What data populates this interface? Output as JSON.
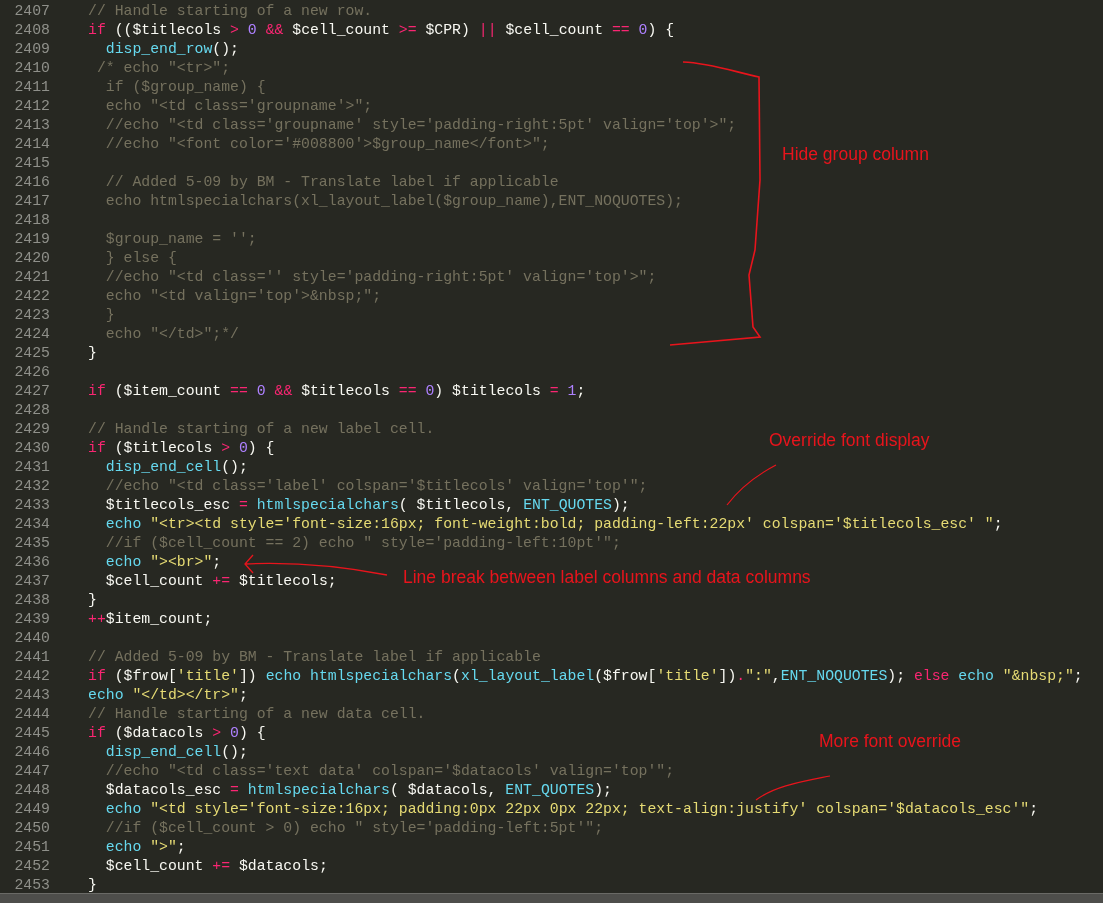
{
  "editor": {
    "lines": [
      {
        "no": "2407",
        "tokens": [
          {
            "kind": "cm",
            "text": "// Handle starting of a new row."
          }
        ]
      },
      {
        "no": "2408",
        "tokens": [
          {
            "kind": "kw",
            "text": "if"
          },
          {
            "kind": "tx",
            "text": " (($titlecols "
          },
          {
            "kind": "kw",
            "text": "> "
          },
          {
            "kind": "num",
            "text": "0 "
          },
          {
            "kind": "kw",
            "text": "&&"
          },
          {
            "kind": "tx",
            "text": " $cell_count "
          },
          {
            "kind": "kw",
            "text": ">="
          },
          {
            "kind": "tx",
            "text": " $CPR) "
          },
          {
            "kind": "kw",
            "text": "||"
          },
          {
            "kind": "tx",
            "text": " $cell_count "
          },
          {
            "kind": "kw",
            "text": "== "
          },
          {
            "kind": "num",
            "text": "0"
          },
          {
            "kind": "tx",
            "text": ") {"
          }
        ]
      },
      {
        "no": "2409",
        "tokens": [
          {
            "kind": "fn",
            "text": "  disp_end_row"
          },
          {
            "kind": "tx",
            "text": "();"
          }
        ]
      },
      {
        "no": "2410",
        "tokens": [
          {
            "kind": "cm",
            "text": " /* echo \"<tr>\";"
          }
        ]
      },
      {
        "no": "2411",
        "tokens": [
          {
            "kind": "cm",
            "text": "  if ($group_name) {"
          }
        ]
      },
      {
        "no": "2412",
        "tokens": [
          {
            "kind": "cm",
            "text": "  echo \"<td class='groupname'>\";"
          }
        ]
      },
      {
        "no": "2413",
        "tokens": [
          {
            "kind": "cm",
            "text": "  //echo \"<td class='groupname' style='padding-right:5pt' valign='top'>\";"
          }
        ]
      },
      {
        "no": "2414",
        "tokens": [
          {
            "kind": "cm",
            "text": "  //echo \"<font color='#008800'>$group_name</font>\";"
          }
        ]
      },
      {
        "no": "2415"
      },
      {
        "no": "2416",
        "tokens": [
          {
            "kind": "cm",
            "text": "  // Added 5-09 by BM - Translate label if applicable"
          }
        ]
      },
      {
        "no": "2417",
        "tokens": [
          {
            "kind": "cm",
            "text": "  echo htmlspecialchars(xl_layout_label($group_name),ENT_NOQUOTES);"
          }
        ]
      },
      {
        "no": "2418"
      },
      {
        "no": "2419",
        "tokens": [
          {
            "kind": "cm",
            "text": "  $group_name = '';"
          }
        ]
      },
      {
        "no": "2420",
        "tokens": [
          {
            "kind": "cm",
            "text": "  } else {"
          }
        ]
      },
      {
        "no": "2421",
        "tokens": [
          {
            "kind": "cm",
            "text": "  //echo \"<td class='' style='padding-right:5pt' valign='top'>\";"
          }
        ]
      },
      {
        "no": "2422",
        "tokens": [
          {
            "kind": "cm",
            "text": "  echo \"<td valign='top'>&nbsp;\";"
          }
        ]
      },
      {
        "no": "2423",
        "tokens": [
          {
            "kind": "cm",
            "text": "  }"
          }
        ]
      },
      {
        "no": "2424",
        "tokens": [
          {
            "kind": "cm",
            "text": "  echo \"</td>\";*/"
          }
        ]
      },
      {
        "no": "2425",
        "tokens": [
          {
            "kind": "tx",
            "text": "}"
          }
        ]
      },
      {
        "no": "2426"
      },
      {
        "no": "2427",
        "tokens": [
          {
            "kind": "kw",
            "text": "if"
          },
          {
            "kind": "tx",
            "text": " ($item_count "
          },
          {
            "kind": "kw",
            "text": "== "
          },
          {
            "kind": "num",
            "text": "0 "
          },
          {
            "kind": "kw",
            "text": "&&"
          },
          {
            "kind": "tx",
            "text": " $titlecols "
          },
          {
            "kind": "kw",
            "text": "== "
          },
          {
            "kind": "num",
            "text": "0"
          },
          {
            "kind": "tx",
            "text": ") $titlecols "
          },
          {
            "kind": "kw",
            "text": "= "
          },
          {
            "kind": "num",
            "text": "1"
          },
          {
            "kind": "tx",
            "text": ";"
          }
        ]
      },
      {
        "no": "2428"
      },
      {
        "no": "2429",
        "tokens": [
          {
            "kind": "cm",
            "text": "// Handle starting of a new label cell."
          }
        ]
      },
      {
        "no": "2430",
        "tokens": [
          {
            "kind": "kw",
            "text": "if"
          },
          {
            "kind": "tx",
            "text": " ($titlecols "
          },
          {
            "kind": "kw",
            "text": "> "
          },
          {
            "kind": "num",
            "text": "0"
          },
          {
            "kind": "tx",
            "text": ") {"
          }
        ]
      },
      {
        "no": "2431",
        "tokens": [
          {
            "kind": "fn",
            "text": "  disp_end_cell"
          },
          {
            "kind": "tx",
            "text": "();"
          }
        ]
      },
      {
        "no": "2432",
        "tokens": [
          {
            "kind": "cm",
            "text": "  //echo \"<td class='label' colspan='$titlecols' valign='top'\";"
          }
        ]
      },
      {
        "no": "2433",
        "tokens": [
          {
            "kind": "tx",
            "text": "  $titlecols_esc "
          },
          {
            "kind": "kw",
            "text": "= "
          },
          {
            "kind": "fn",
            "text": "htmlspecialchars"
          },
          {
            "kind": "tx",
            "text": "( $titlecols, "
          },
          {
            "kind": "fn",
            "text": "ENT_QUOTES"
          },
          {
            "kind": "tx",
            "text": ");"
          }
        ]
      },
      {
        "no": "2434",
        "tokens": [
          {
            "kind": "fn",
            "text": "  echo "
          },
          {
            "kind": "str",
            "text": "\"<tr><td style='font-size:16px; font-weight:bold; padding-left:22px' colspan='$titlecols_esc' \""
          },
          {
            "kind": "tx",
            "text": ";"
          }
        ]
      },
      {
        "no": "2435",
        "tokens": [
          {
            "kind": "cm",
            "text": "  //if ($cell_count == 2) echo \" style='padding-left:10pt'\";"
          }
        ]
      },
      {
        "no": "2436",
        "tokens": [
          {
            "kind": "fn",
            "text": "  echo "
          },
          {
            "kind": "str",
            "text": "\"><br>\""
          },
          {
            "kind": "tx",
            "text": ";"
          }
        ]
      },
      {
        "no": "2437",
        "tokens": [
          {
            "kind": "tx",
            "text": "  $cell_count "
          },
          {
            "kind": "kw",
            "text": "+="
          },
          {
            "kind": "tx",
            "text": " $titlecols;"
          }
        ]
      },
      {
        "no": "2438",
        "tokens": [
          {
            "kind": "tx",
            "text": "}"
          }
        ]
      },
      {
        "no": "2439",
        "tokens": [
          {
            "kind": "kw",
            "text": "++"
          },
          {
            "kind": "tx",
            "text": "$item_count;"
          }
        ]
      },
      {
        "no": "2440"
      },
      {
        "no": "2441",
        "tokens": [
          {
            "kind": "cm",
            "text": "// Added 5-09 by BM - Translate label if applicable"
          }
        ]
      },
      {
        "no": "2442",
        "tokens": [
          {
            "kind": "kw",
            "text": "if"
          },
          {
            "kind": "tx",
            "text": " ($frow["
          },
          {
            "kind": "str",
            "text": "'title'"
          },
          {
            "kind": "tx",
            "text": "]) "
          },
          {
            "kind": "fn",
            "text": "echo htmlspecialchars"
          },
          {
            "kind": "tx",
            "text": "("
          },
          {
            "kind": "fn",
            "text": "xl_layout_label"
          },
          {
            "kind": "tx",
            "text": "($frow["
          },
          {
            "kind": "str",
            "text": "'title'"
          },
          {
            "kind": "tx",
            "text": "])"
          },
          {
            "kind": "kw",
            "text": "."
          },
          {
            "kind": "str",
            "text": "\":\""
          },
          {
            "kind": "tx",
            "text": ","
          },
          {
            "kind": "fn",
            "text": "ENT_NOQUOTES"
          },
          {
            "kind": "tx",
            "text": "); "
          },
          {
            "kind": "kw",
            "text": "else "
          },
          {
            "kind": "fn",
            "text": "echo "
          },
          {
            "kind": "str",
            "text": "\"&nbsp;\""
          },
          {
            "kind": "tx",
            "text": ";"
          }
        ]
      },
      {
        "no": "2443",
        "tokens": [
          {
            "kind": "fn",
            "text": "echo "
          },
          {
            "kind": "str",
            "text": "\"</td></tr>\""
          },
          {
            "kind": "tx",
            "text": ";"
          }
        ]
      },
      {
        "no": "2444",
        "tokens": [
          {
            "kind": "cm",
            "text": "// Handle starting of a new data cell."
          }
        ]
      },
      {
        "no": "2445",
        "tokens": [
          {
            "kind": "kw",
            "text": "if"
          },
          {
            "kind": "tx",
            "text": " ($datacols "
          },
          {
            "kind": "kw",
            "text": "> "
          },
          {
            "kind": "num",
            "text": "0"
          },
          {
            "kind": "tx",
            "text": ") {"
          }
        ]
      },
      {
        "no": "2446",
        "tokens": [
          {
            "kind": "fn",
            "text": "  disp_end_cell"
          },
          {
            "kind": "tx",
            "text": "();"
          }
        ]
      },
      {
        "no": "2447",
        "tokens": [
          {
            "kind": "cm",
            "text": "  //echo \"<td class='text data' colspan='$datacols' valign='top'\";"
          }
        ]
      },
      {
        "no": "2448",
        "tokens": [
          {
            "kind": "tx",
            "text": "  $datacols_esc "
          },
          {
            "kind": "kw",
            "text": "= "
          },
          {
            "kind": "fn",
            "text": "htmlspecialchars"
          },
          {
            "kind": "tx",
            "text": "( $datacols, "
          },
          {
            "kind": "fn",
            "text": "ENT_QUOTES"
          },
          {
            "kind": "tx",
            "text": ");"
          }
        ]
      },
      {
        "no": "2449",
        "tokens": [
          {
            "kind": "fn",
            "text": "  echo "
          },
          {
            "kind": "str",
            "text": "\"<td style='font-size:16px; padding:0px 22px 0px 22px; text-align:justify' colspan='$datacols_esc'\""
          },
          {
            "kind": "tx",
            "text": ";"
          }
        ]
      },
      {
        "no": "2450",
        "tokens": [
          {
            "kind": "cm",
            "text": "  //if ($cell_count > 0) echo \" style='padding-left:5pt'\";"
          }
        ]
      },
      {
        "no": "2451",
        "tokens": [
          {
            "kind": "fn",
            "text": "  echo "
          },
          {
            "kind": "str",
            "text": "\">\""
          },
          {
            "kind": "tx",
            "text": ";"
          }
        ]
      },
      {
        "no": "2452",
        "tokens": [
          {
            "kind": "tx",
            "text": "  $cell_count "
          },
          {
            "kind": "kw",
            "text": "+="
          },
          {
            "kind": "tx",
            "text": " $datacols;"
          }
        ]
      },
      {
        "no": "2453",
        "tokens": [
          {
            "kind": "tx",
            "text": "}"
          }
        ]
      }
    ]
  },
  "annotations": [
    {
      "kind": "bracket",
      "text": "Hide group column"
    },
    {
      "kind": "line",
      "text": "Override font display"
    },
    {
      "kind": "arrow",
      "text": "Line break between label columns and data columns"
    },
    {
      "kind": "line",
      "text": "More font override"
    }
  ]
}
